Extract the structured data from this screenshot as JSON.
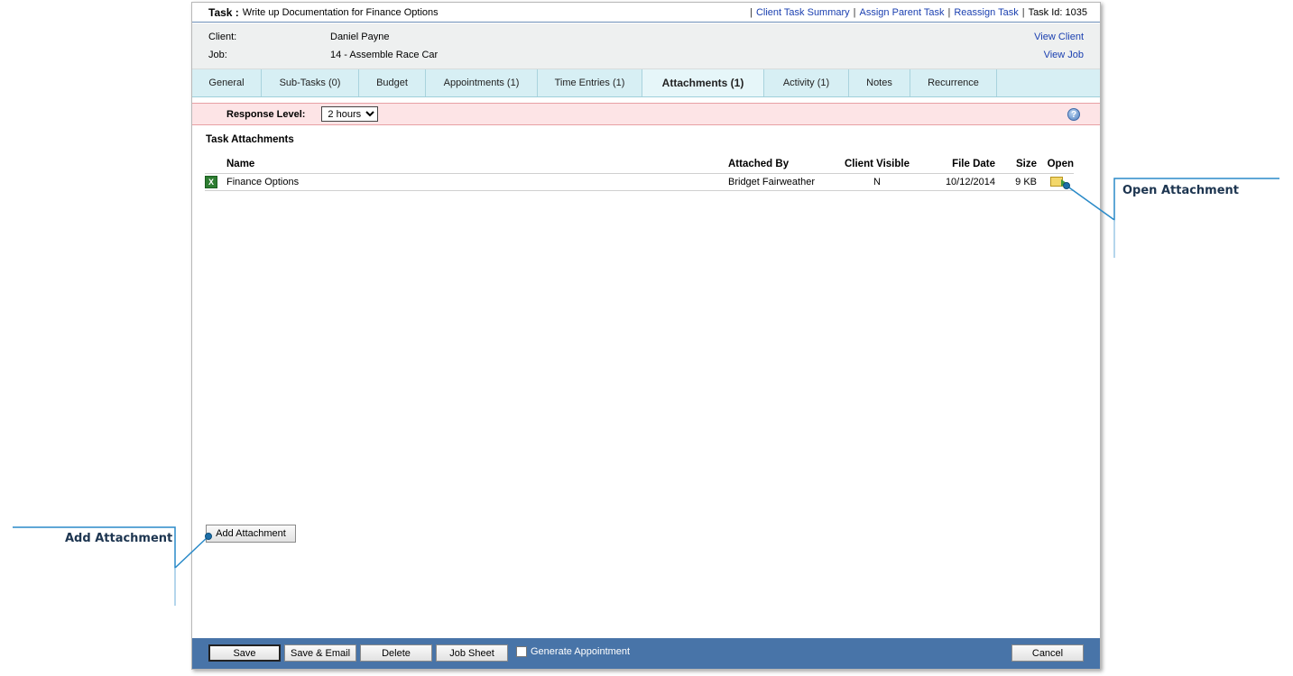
{
  "header": {
    "task_label": "Task :",
    "task_name": "Write up Documentation for Finance Options",
    "sep": "|",
    "links": [
      "Client Task Summary",
      "Assign Parent Task",
      "Reassign Task"
    ],
    "task_id": "Task Id: 1035"
  },
  "info": {
    "client_label": "Client:",
    "client_value": "Daniel Payne",
    "client_link": "View Client",
    "job_label": "Job:",
    "job_value": "14 - Assemble Race Car",
    "job_link": "View Job"
  },
  "tabs": [
    "General",
    "Sub-Tasks (0)",
    "Budget",
    "Appointments (1)",
    "Time Entries (1)",
    "Attachments (1)",
    "Activity (1)",
    "Notes",
    "Recurrence"
  ],
  "active_tab": "Attachments (1)",
  "response": {
    "label": "Response Level:",
    "selected": "2 hours"
  },
  "attachments": {
    "title": "Task Attachments",
    "columns": [
      "Name",
      "Attached By",
      "Client Visible",
      "File Date",
      "Size",
      "Open"
    ],
    "rows": [
      {
        "icon": "excel-file-icon",
        "name": "Finance Options",
        "attached_by": "Bridget Fairweather",
        "client_visible": "N",
        "file_date": "10/12/2014",
        "size": "9 KB",
        "open_icon": "open-folder-icon"
      }
    ],
    "add_button": "Add Attachment"
  },
  "footer": {
    "save": "Save",
    "save_email": "Save & Email",
    "delete": "Delete",
    "job_sheet": "Job Sheet",
    "generate_appointment": "Generate Appointment",
    "generate_checked": false,
    "cancel": "Cancel"
  },
  "callouts": {
    "open": "Open Attachment",
    "add": "Add Attachment"
  },
  "colors": {
    "title_link": "#1a3fb0",
    "tab_bar": "#d7eff4",
    "response_bar": "#fde4e6",
    "footer_bar": "#4874a8",
    "callout": "#1d6fa8"
  }
}
